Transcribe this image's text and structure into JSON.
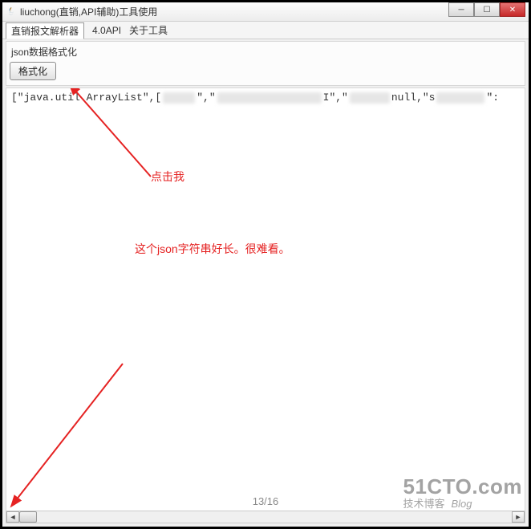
{
  "window": {
    "title": "liuchong(直销,API辅助)工具使用"
  },
  "menu": {
    "tab_active": "直销报文解析器",
    "item2": "4.0API",
    "item3": "关于工具"
  },
  "section": {
    "title": "json数据格式化",
    "format_button": "格式化"
  },
  "code": {
    "prefix": "[\"java.util.ArrayList\",[",
    "mid1": "\",\"",
    "mid2": "I\",\"",
    "mid3": "null,\"s",
    "tail": "\":"
  },
  "annotations": {
    "click_me": "点击我",
    "long_json": "这个json字符串好长。很难看。"
  },
  "page_indicator": "13/16",
  "watermark": {
    "big": "51CTO.com",
    "small1": "技术博客",
    "small2": "Blog"
  }
}
